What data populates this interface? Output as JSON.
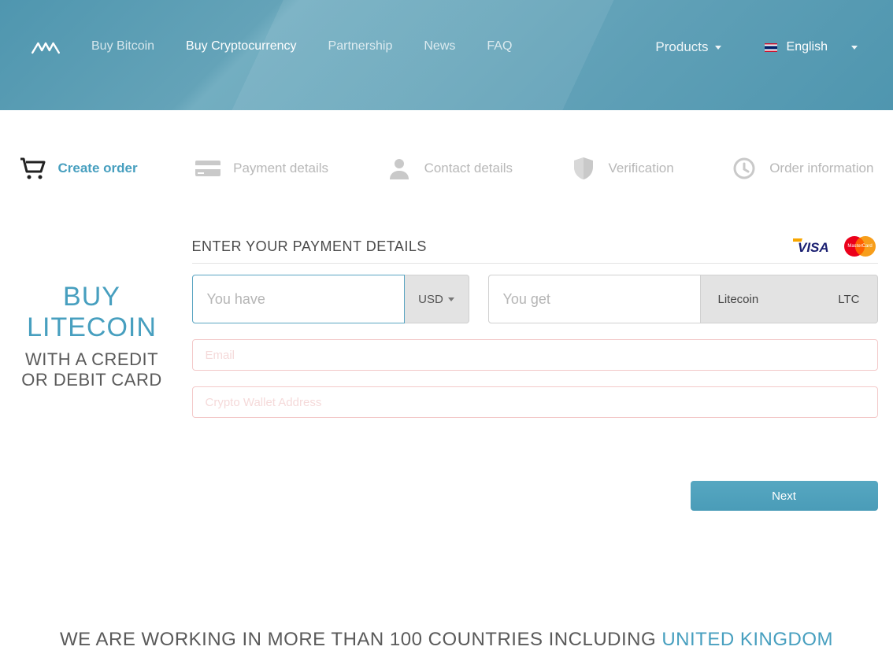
{
  "header": {
    "nav": {
      "buy_bitcoin": "Buy Bitcoin",
      "buy_crypto": "Buy Cryptocurrency",
      "partnership": "Partnership",
      "news": "News",
      "faq": "FAQ"
    },
    "products_label": "Products",
    "lang_label": "English"
  },
  "steps": {
    "create_order": "Create order",
    "payment_details": "Payment details",
    "contact_details": "Contact details",
    "verification": "Verification",
    "order_info": "Order information"
  },
  "left": {
    "title": "BUY LITECOIN",
    "subtitle": "WITH A CREDIT OR DEBIT CARD"
  },
  "form": {
    "heading": "ENTER YOUR PAYMENT DETAILS",
    "you_have_placeholder": "You have",
    "you_get_placeholder": "You get",
    "currency": "USD",
    "crypto_name": "Litecoin",
    "crypto_symbol": "LTC",
    "email_placeholder": "Email",
    "wallet_placeholder": "Crypto Wallet Address",
    "next_label": "Next"
  },
  "tagline": {
    "text": "WE ARE WORKING IN MORE THAN 100 COUNTRIES INCLUDING ",
    "country": "UNITED KINGDOM"
  },
  "card_brands": {
    "visa": "VISA",
    "mc": "MasterCard"
  }
}
